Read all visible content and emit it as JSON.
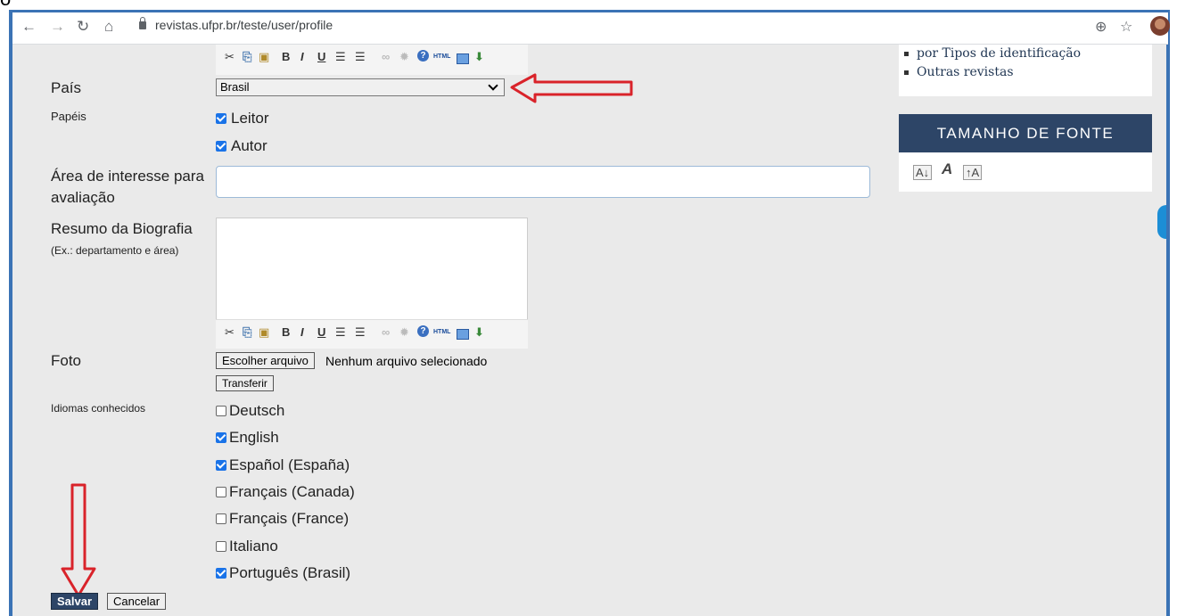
{
  "browser": {
    "url": "revistas.ufpr.br/teste/user/profile",
    "icons": [
      "back-icon",
      "forward-icon",
      "reload-icon",
      "home-icon",
      "lock-icon",
      "zoom-icon",
      "star-icon",
      "avatar"
    ]
  },
  "form": {
    "country_label": "País",
    "country_value": "Brasil",
    "roles_label": "Papéis",
    "roles": [
      {
        "label": "Leitor",
        "checked": true
      },
      {
        "label": "Autor",
        "checked": true
      }
    ],
    "review_interest_label_1": "Área de interesse para",
    "review_interest_label_2": "avaliação",
    "review_interest_value": "",
    "bio_label": "Resumo da Biografia",
    "bio_hint": "(Ex.: departamento e área)",
    "bio_value": "",
    "photo_label": "Foto",
    "choose_file_label": "Escolher arquivo",
    "no_file_label": "Nenhum arquivo selecionado",
    "upload_label": "Transferir",
    "languages_label": "Idiomas conhecidos",
    "languages": [
      {
        "label": "Deutsch",
        "checked": false
      },
      {
        "label": "English",
        "checked": true
      },
      {
        "label": "Español (España)",
        "checked": true
      },
      {
        "label": "Français (Canada)",
        "checked": false
      },
      {
        "label": "Français (France)",
        "checked": false
      },
      {
        "label": "Italiano",
        "checked": false
      },
      {
        "label": "Português (Brasil)",
        "checked": true
      }
    ],
    "save_label": "Salvar",
    "cancel_label": "Cancelar",
    "toolbar_glyphs": [
      "✂",
      "⎘",
      "📋",
      "B",
      "I",
      "U",
      "☰",
      "☰",
      "∞",
      "✹",
      "?",
      "HTML",
      "▤",
      "⬇"
    ]
  },
  "sidebar": {
    "links": [
      "por Tipos de identificação",
      "Outras revistas"
    ],
    "font_size_title": "TAMANHO DE FONTE",
    "font_size_controls": [
      "A↓",
      "A",
      "↑A"
    ]
  },
  "colors": {
    "frame": "#3b73b5",
    "annotation_arrow": "#d9232a",
    "sidebar_header": "#2d4567",
    "checkbox": "#1a73e8"
  }
}
